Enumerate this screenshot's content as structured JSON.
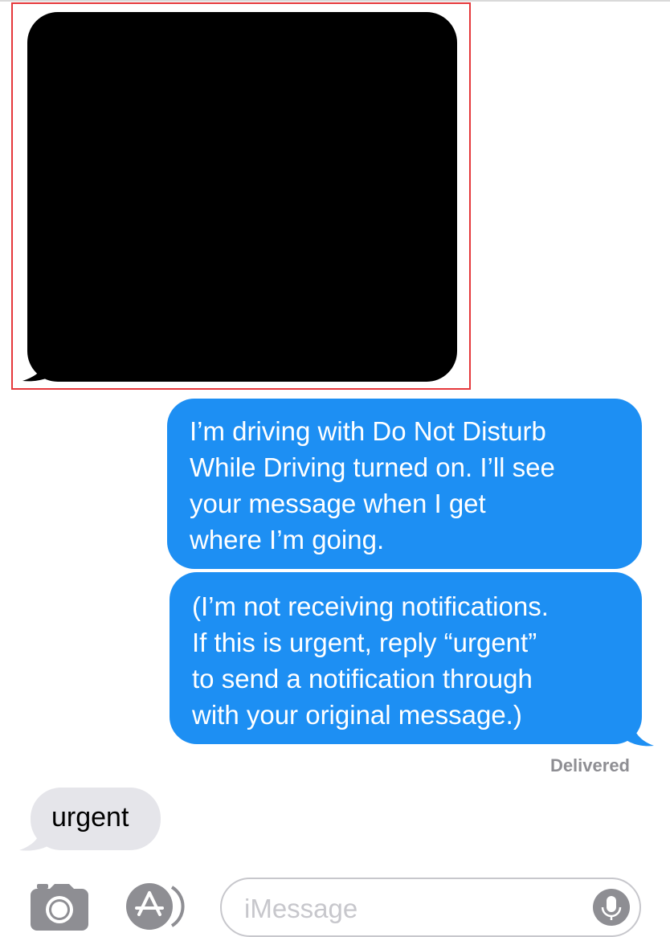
{
  "conversation": {
    "redacted_message": "",
    "sent_messages": [
      {
        "lines": [
          "I’m driving with Do Not Disturb",
          "While Driving turned on. I’ll see",
          "your message when I get",
          "where I’m going."
        ]
      },
      {
        "lines": [
          "(I’m not receiving notifications.",
          "If this is urgent, reply “urgent”",
          "to send a notification through",
          "with your original message.)"
        ]
      }
    ],
    "status": "Delivered",
    "received_reply": "urgent"
  },
  "composer": {
    "placeholder": "iMessage",
    "icons": {
      "camera": "camera-icon",
      "apps": "app-store-icon",
      "mic": "microphone-icon"
    }
  },
  "colors": {
    "sent_bubble": "#1d8ff3",
    "received_bubble": "#e5e5ea",
    "highlight": "#e5383b",
    "icon_gray": "#8e8e93"
  }
}
